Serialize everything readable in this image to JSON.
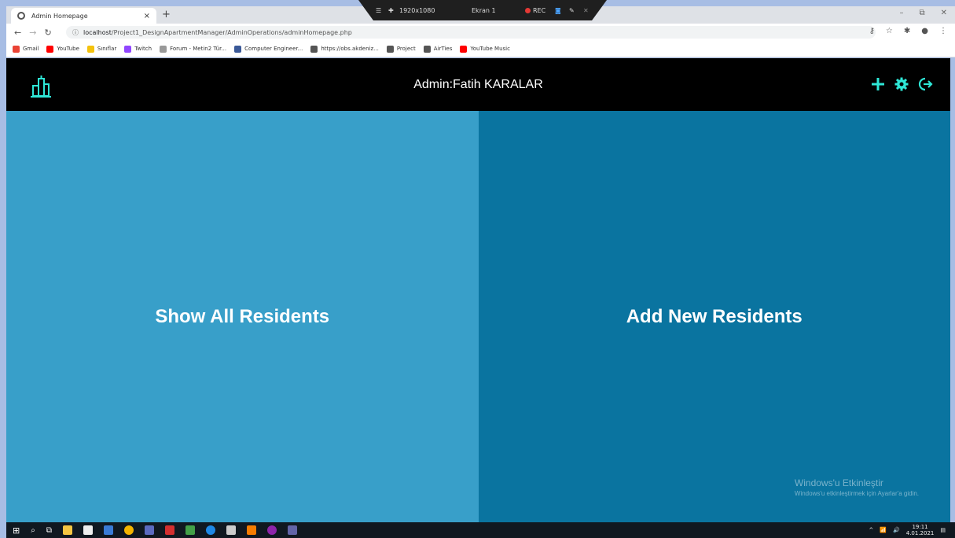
{
  "browser": {
    "tab_title": "Admin Homepage",
    "tab_close": "×",
    "new_tab": "+",
    "url_host": "localhost",
    "url_path": "/Project1_DesignApartmentManager/AdminOperations/adminHomepage.php",
    "window_controls": [
      "–",
      "⧉",
      "✕"
    ],
    "bookmarks": [
      {
        "label": "Gmail",
        "color": "#ea4335"
      },
      {
        "label": "YouTube",
        "color": "#ff0000"
      },
      {
        "label": "Sınıflar",
        "color": "#f4c20d"
      },
      {
        "label": "Twitch",
        "color": "#9146ff"
      },
      {
        "label": "Forum - Metin2 Tür...",
        "color": "#999999"
      },
      {
        "label": "Computer Engineer...",
        "color": "#3b5998"
      },
      {
        "label": "https://obs.akdeniz...",
        "color": "#555555"
      },
      {
        "label": "Project",
        "color": "#555555"
      },
      {
        "label": "AirTies",
        "color": "#555555"
      },
      {
        "label": "YouTube Music",
        "color": "#ff0000"
      }
    ]
  },
  "recorder": {
    "resolution": "1920x1080",
    "screen": "Ekran 1",
    "rec": "REC"
  },
  "header": {
    "title": "Admin:Fatih KARALAR"
  },
  "panels": {
    "left_label": "Show All Residents",
    "right_label": "Add New Residents"
  },
  "watermark": {
    "line1": "Windows'u Etkinleştir",
    "line2": "Windows'u etkinleştirmek için Ayarlar'a gidin."
  },
  "taskbar": {
    "time": "19:11",
    "date": "4.01.2021"
  },
  "colors": {
    "accent": "#2ee6d6",
    "left_panel": "#389fc9",
    "right_panel": "#0a74a0",
    "header_bg": "#000000"
  }
}
